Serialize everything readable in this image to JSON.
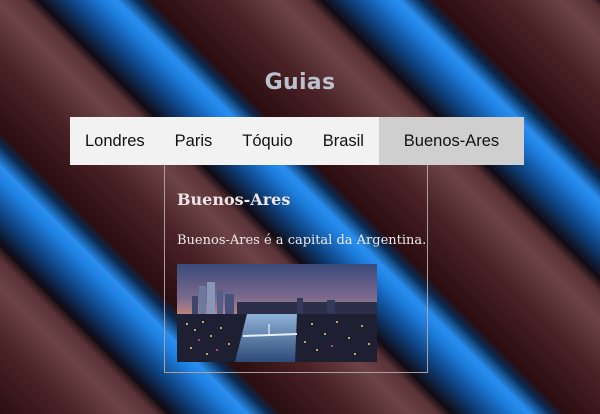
{
  "page": {
    "title": "Guias"
  },
  "tabs": [
    {
      "label": "Londres",
      "active": false
    },
    {
      "label": "Paris",
      "active": false
    },
    {
      "label": "Tóquio",
      "active": false
    },
    {
      "label": "Brasil",
      "active": false
    },
    {
      "label": "Buenos-Ares",
      "active": true
    }
  ],
  "panel": {
    "heading": "Buenos-Ares",
    "text": "Buenos-Ares é a capital da Argentina.",
    "image_description": "night skyline of a city by the river"
  },
  "colors": {
    "tab_bar": "#f2f2f2",
    "tab_active": "#cfcfcf",
    "title": "#b9c2cc"
  }
}
